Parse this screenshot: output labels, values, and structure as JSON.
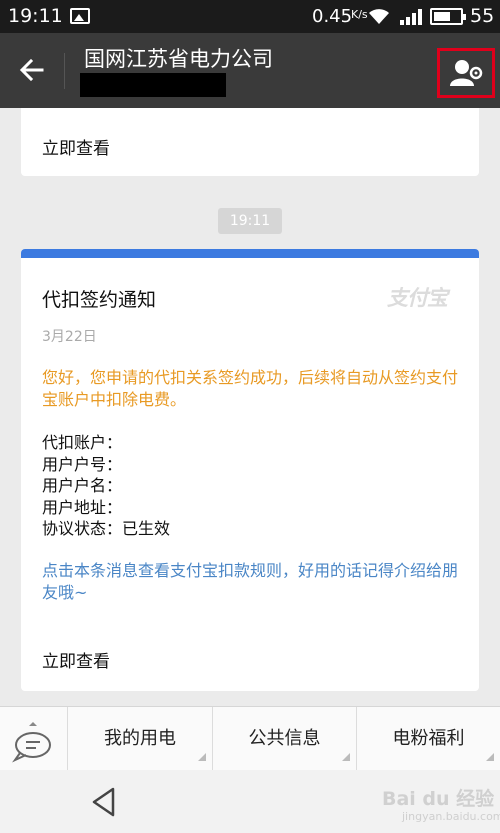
{
  "status_bar": {
    "time": "19:11",
    "speed": "0.45",
    "speed_unit": "K/s",
    "battery": "55"
  },
  "header": {
    "title": "国网江苏省电力公司"
  },
  "messages": {
    "top_card": {
      "view_label": "立即查看"
    },
    "timestamp": "19:11",
    "card": {
      "title": "代扣签约通知",
      "watermark": "支付宝",
      "date": "3月22日",
      "notice": "您好，您申请的代扣关系签约成功，后续将自动从签约支付宝账户中扣除电费。",
      "fields": [
        {
          "label": "代扣账户：",
          "value": ""
        },
        {
          "label": "用户户号：",
          "value": ""
        },
        {
          "label": "用户户名：",
          "value": ""
        },
        {
          "label": "用户地址：",
          "value": ""
        },
        {
          "label": "协议状态：",
          "value": "已生效"
        }
      ],
      "rules_link": "点击本条消息查看支付宝扣款规则，好用的话记得介绍给朋友哦~",
      "view_label": "立即查看"
    }
  },
  "menu": {
    "items": [
      {
        "label": "我的用电"
      },
      {
        "label": "公共信息"
      },
      {
        "label": "电粉福利"
      }
    ]
  },
  "watermark": {
    "brand": "Bai du 经验",
    "url": "jingyan.baidu.com"
  },
  "colors": {
    "header_bg": "#3a3a3a",
    "accent_blue": "#3c7ae0",
    "notice_orange": "#e89a24",
    "link_blue": "#4a86c6",
    "highlight_red": "#e0001b"
  }
}
